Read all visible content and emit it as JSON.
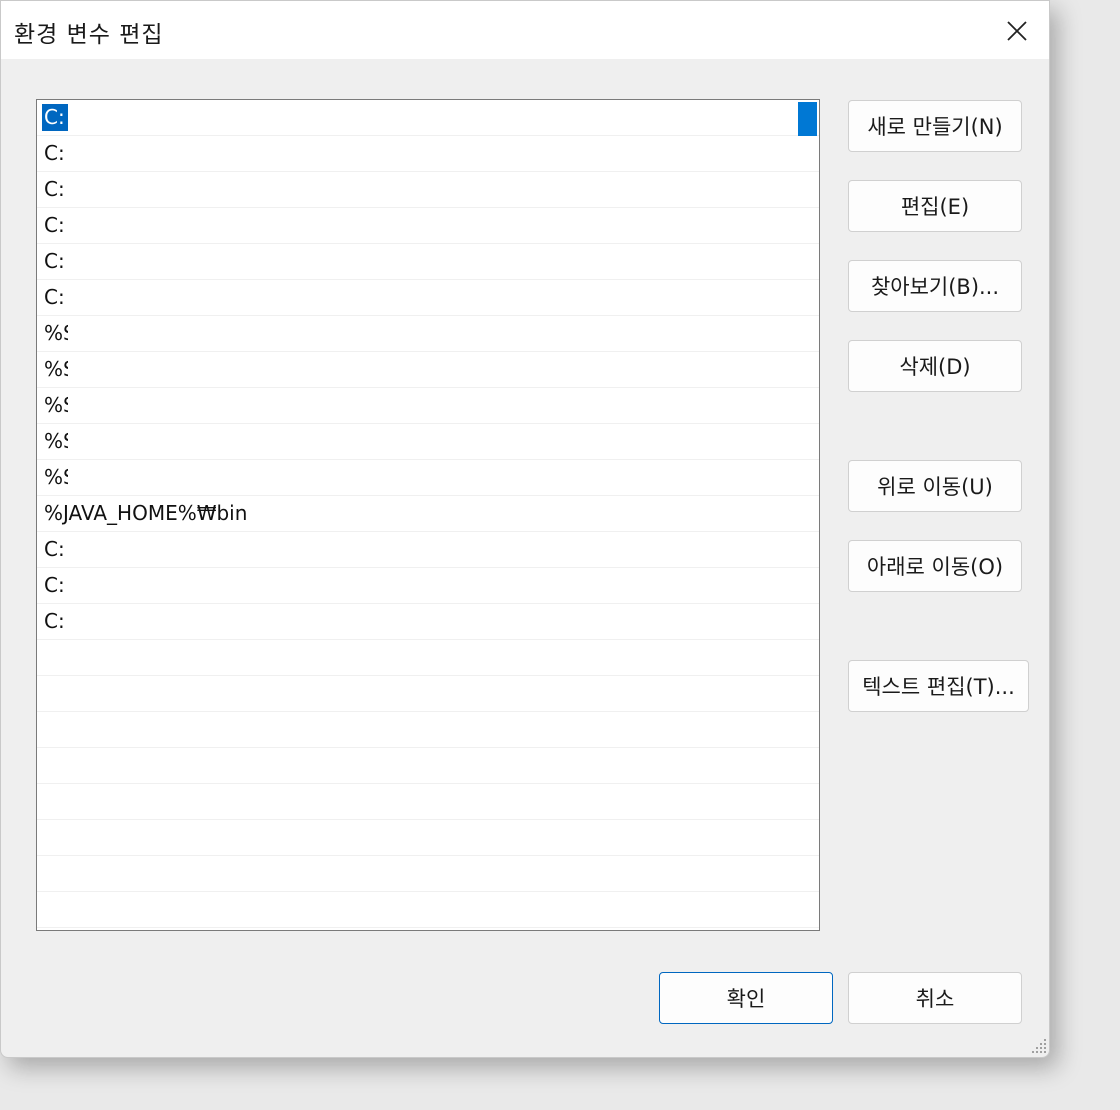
{
  "window": {
    "title": "환경 변수 편집"
  },
  "path_list": {
    "items": [
      {
        "text": "C:",
        "selected": true
      },
      {
        "text": "C:",
        "selected": false
      },
      {
        "text": "C:",
        "selected": false
      },
      {
        "text": "C:",
        "selected": false
      },
      {
        "text": "C:",
        "selected": false
      },
      {
        "text": "C:",
        "selected": false
      },
      {
        "text": "%S",
        "selected": false
      },
      {
        "text": "%S",
        "selected": false
      },
      {
        "text": "%S",
        "selected": false
      },
      {
        "text": "%S",
        "selected": false
      },
      {
        "text": "%S",
        "selected": false
      },
      {
        "text": "%JAVA_HOME%₩bin",
        "selected": false
      },
      {
        "text": "C:",
        "selected": false
      },
      {
        "text": "C:",
        "selected": false
      },
      {
        "text": "C:",
        "selected": false
      }
    ]
  },
  "buttons": {
    "new": "새로 만들기(N)",
    "edit": "편집(E)",
    "browse": "찾아보기(B)...",
    "delete": "삭제(D)",
    "move_up": "위로 이동(U)",
    "move_down": "아래로 이동(O)",
    "edit_text": "텍스트 편집(T)...",
    "ok": "확인",
    "cancel": "취소"
  },
  "colors": {
    "selection": "#0067c0",
    "scroll_thumb": "#0078d4",
    "primary_border": "#0067c0"
  }
}
